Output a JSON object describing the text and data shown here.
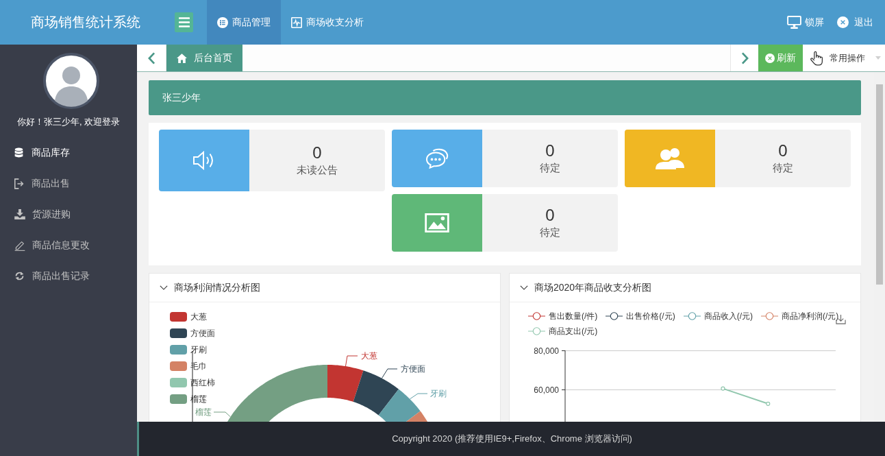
{
  "header": {
    "title": "商场销售统计系统",
    "nav": [
      {
        "label": "商品管理",
        "selected": true
      },
      {
        "label": "商场收支分析",
        "selected": false
      }
    ],
    "actions": [
      "锁屏",
      "退出"
    ]
  },
  "sidebar": {
    "greeting": "你好！张三少年, 欢迎登录",
    "items": [
      {
        "label": "商品库存",
        "selected": true
      },
      {
        "label": "商品出售",
        "selected": false
      },
      {
        "label": "货源进购",
        "selected": false
      },
      {
        "label": "商品信息更改",
        "selected": false
      },
      {
        "label": "商品出售记录",
        "selected": false
      }
    ]
  },
  "tab_bar": {
    "tabs": [
      {
        "label": "后台首页",
        "selected": true
      }
    ],
    "refresh_button": "刷新",
    "operations_menu": "常用操作"
  },
  "banner": "张三少年",
  "stat_cards": [
    {
      "value": "0",
      "label": "未读公告",
      "color": "#58aee8"
    },
    {
      "value": "0",
      "label": "待定",
      "color": "#58aee8"
    },
    {
      "value": "0",
      "label": "待定",
      "color": "#f0b723"
    },
    {
      "value": "0",
      "label": "待定",
      "color": "#5fb878"
    }
  ],
  "profit_chart": {
    "title": "商场利润情况分析图",
    "items": [
      {
        "label": "大葱",
        "color": "#c23531",
        "slice_label": "大葱"
      },
      {
        "label": "方便面",
        "color": "#2f4554",
        "slice_label": "方便面"
      },
      {
        "label": "牙刷",
        "color": "#61a0a8",
        "slice_label": "牙刷"
      },
      {
        "label": "毛巾",
        "color": "#d48265"
      },
      {
        "label": "西红柿",
        "color": "#91c7ae"
      },
      {
        "label": "榴莲",
        "color": "#749f83",
        "slice_label": "榴莲"
      }
    ]
  },
  "income_chart": {
    "title": "商场2020年商品收支分析图",
    "chart_data": {
      "type": "line",
      "categories": [
        null,
        null,
        null,
        null,
        null,
        null
      ],
      "ylim": [
        43500,
        80000
      ],
      "yticks": [
        {
          "value": 60000,
          "label": "60,000"
        },
        {
          "value": 80000,
          "label": "80,000"
        }
      ],
      "series": [
        {
          "name": "售出数量(/件)",
          "color": "#c23531",
          "marker": "circle",
          "values": [
            null,
            null,
            null,
            null,
            null,
            null
          ]
        },
        {
          "name": "出售价格(/元)",
          "color": "#2f4554",
          "marker": "circle",
          "values": [
            null,
            null,
            null,
            null,
            null,
            null
          ]
        },
        {
          "name": "商品收入(/元)",
          "color": "#61a0a8",
          "marker": "circle",
          "values": [
            null,
            null,
            null,
            null,
            null,
            null
          ]
        },
        {
          "name": "商品净利润(/元)",
          "color": "#d48265",
          "marker": "circle",
          "values": [
            null,
            null,
            null,
            null,
            null,
            null
          ]
        },
        {
          "name": "商品支出(/元)",
          "color": "#91c7ae",
          "marker": "circle",
          "values": [
            null,
            null,
            null,
            60500,
            52700,
            null
          ]
        }
      ]
    }
  },
  "footer": "Copyright 2020 (推荐使用IE9+,Firefox、Chrome 浏览器访问)"
}
